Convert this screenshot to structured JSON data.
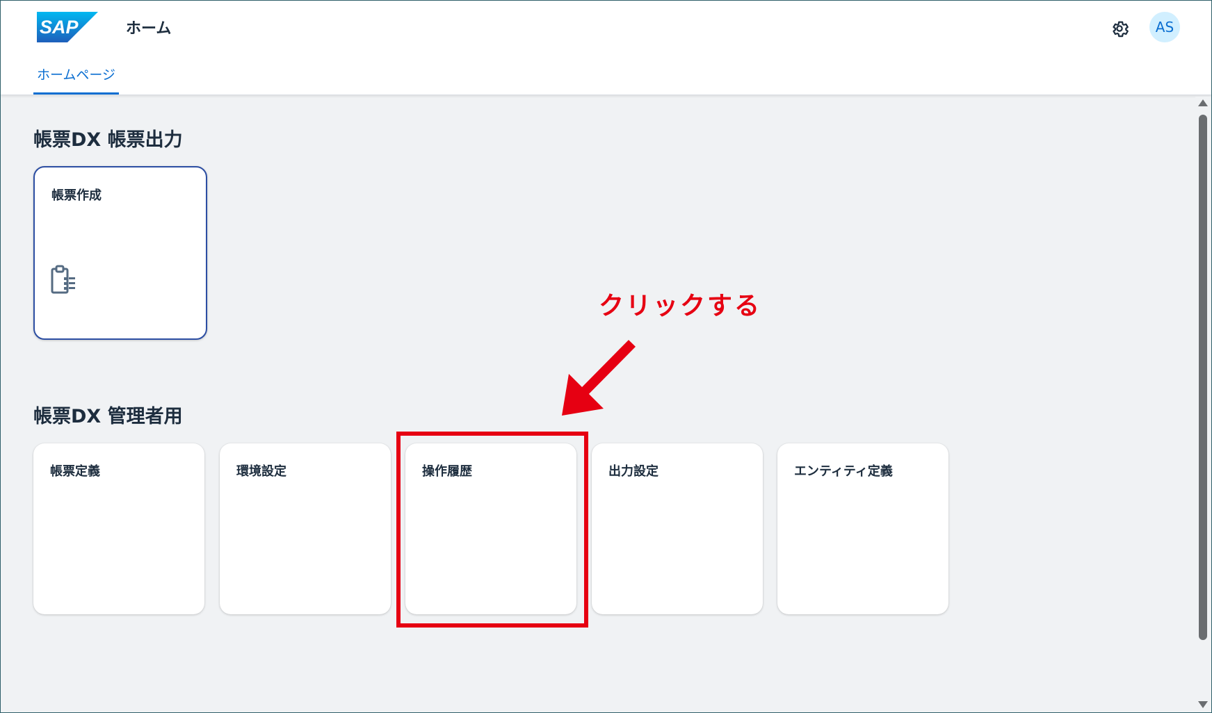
{
  "header": {
    "logo_text": "SAP",
    "app_title": "ホーム",
    "avatar_initials": "AS",
    "tab_label": "ホームページ"
  },
  "sections": [
    {
      "title": "帳票DX 帳票出力",
      "tiles": [
        {
          "title": "帳票作成",
          "icon": "clipboard-list-icon"
        }
      ]
    },
    {
      "title": "帳票DX 管理者用",
      "tiles": [
        {
          "title": "帳票定義"
        },
        {
          "title": "環境設定"
        },
        {
          "title": "操作履歴"
        },
        {
          "title": "出力設定"
        },
        {
          "title": "エンティティ定義"
        }
      ]
    }
  ],
  "annotation": {
    "callout": "クリックする",
    "color": "#e60012"
  },
  "colors": {
    "accent": "#0a6ed1",
    "background": "#f0f2f4",
    "text": "#1d2d3e"
  }
}
